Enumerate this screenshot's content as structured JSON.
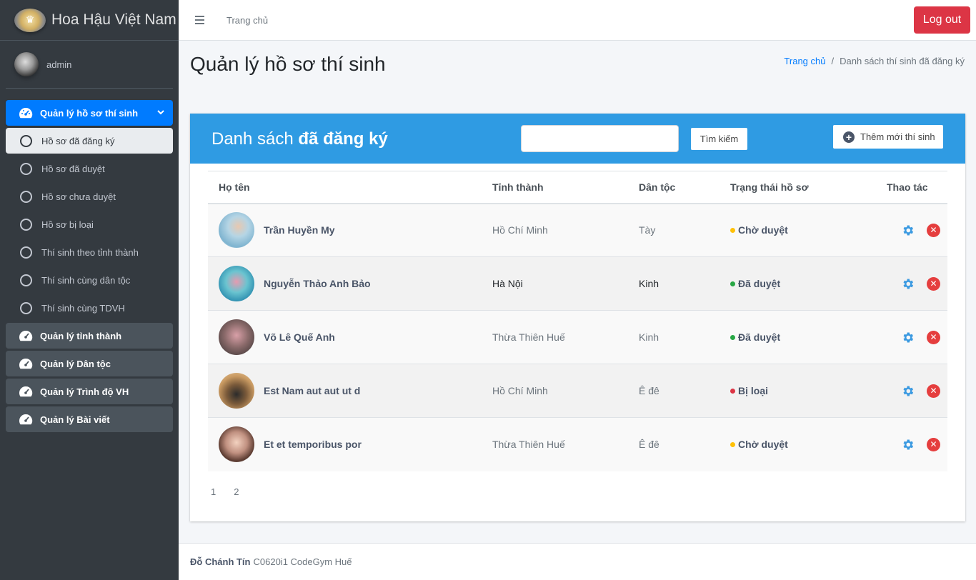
{
  "brand": {
    "name": "Hoa Hậu Việt Nam"
  },
  "user": {
    "name": "admin"
  },
  "sidebar": {
    "main_item": "Quản lý hồ sơ thí sinh",
    "sub_items": [
      "Hồ sơ đã đăng ký",
      "Hồ sơ đã duyệt",
      "Hồ sơ chưa duyệt",
      "Hồ sơ bị loại",
      "Thí sinh theo tỉnh thành",
      "Thí sinh cùng dân tộc",
      "Thí sinh cùng TDVH"
    ],
    "groups": [
      "Quản lý tỉnh thành",
      "Quản lý Dân tộc",
      "Quản lý Trình độ VH",
      "Quản lý Bài viết"
    ]
  },
  "header": {
    "home_link": "Trang chủ",
    "logout_label": "Log out"
  },
  "page": {
    "title": "Quản lý hồ sơ thí sinh",
    "breadcrumb": {
      "home": "Trang chủ",
      "separator": "/",
      "current": "Danh sách thí sinh đã đăng ký"
    }
  },
  "card": {
    "title_prefix": "Danh sách",
    "title_bold": "đã đăng ký",
    "search_value": "",
    "search_button": "Tìm kiếm",
    "add_button": "Thêm mới thí sinh"
  },
  "table": {
    "headers": [
      "Họ tên",
      "Tỉnh thành",
      "Dân tộc",
      "Trạng thái hồ sơ",
      "Thao tác"
    ],
    "rows": [
      {
        "name": "Trần Huyền My",
        "province": "Hồ Chí Minh",
        "ethnic": "Tày",
        "status": "Chờ duyệt",
        "status_color": "#ffc107"
      },
      {
        "name": "Nguyễn Thảo Anh Bảo",
        "province": "Hà Nội",
        "ethnic": "Kinh",
        "status": "Đã duyệt",
        "status_color": "#28a745"
      },
      {
        "name": "Võ Lê Quế Anh",
        "province": "Thừa Thiên Huế",
        "ethnic": "Kinh",
        "status": "Đã duyệt",
        "status_color": "#28a745"
      },
      {
        "name": "Est Nam aut aut ut d",
        "province": "Hồ Chí Minh",
        "ethnic": "Ê đê",
        "status": "Bị loại",
        "status_color": "#dc3545"
      },
      {
        "name": "Et et temporibus por",
        "province": "Thừa Thiên Huế",
        "ethnic": "Ê đê",
        "status": "Chờ duyệt",
        "status_color": "#ffc107"
      }
    ]
  },
  "pagination": [
    "1",
    "2"
  ],
  "footer": {
    "author": "Đỗ Chánh Tín",
    "text": "C0620i1 CodeGym Huế"
  },
  "colors": {
    "primary": "#007bff",
    "card_header": "#2f9be3",
    "danger": "#dc3545",
    "gear": "#3b9ae1"
  }
}
